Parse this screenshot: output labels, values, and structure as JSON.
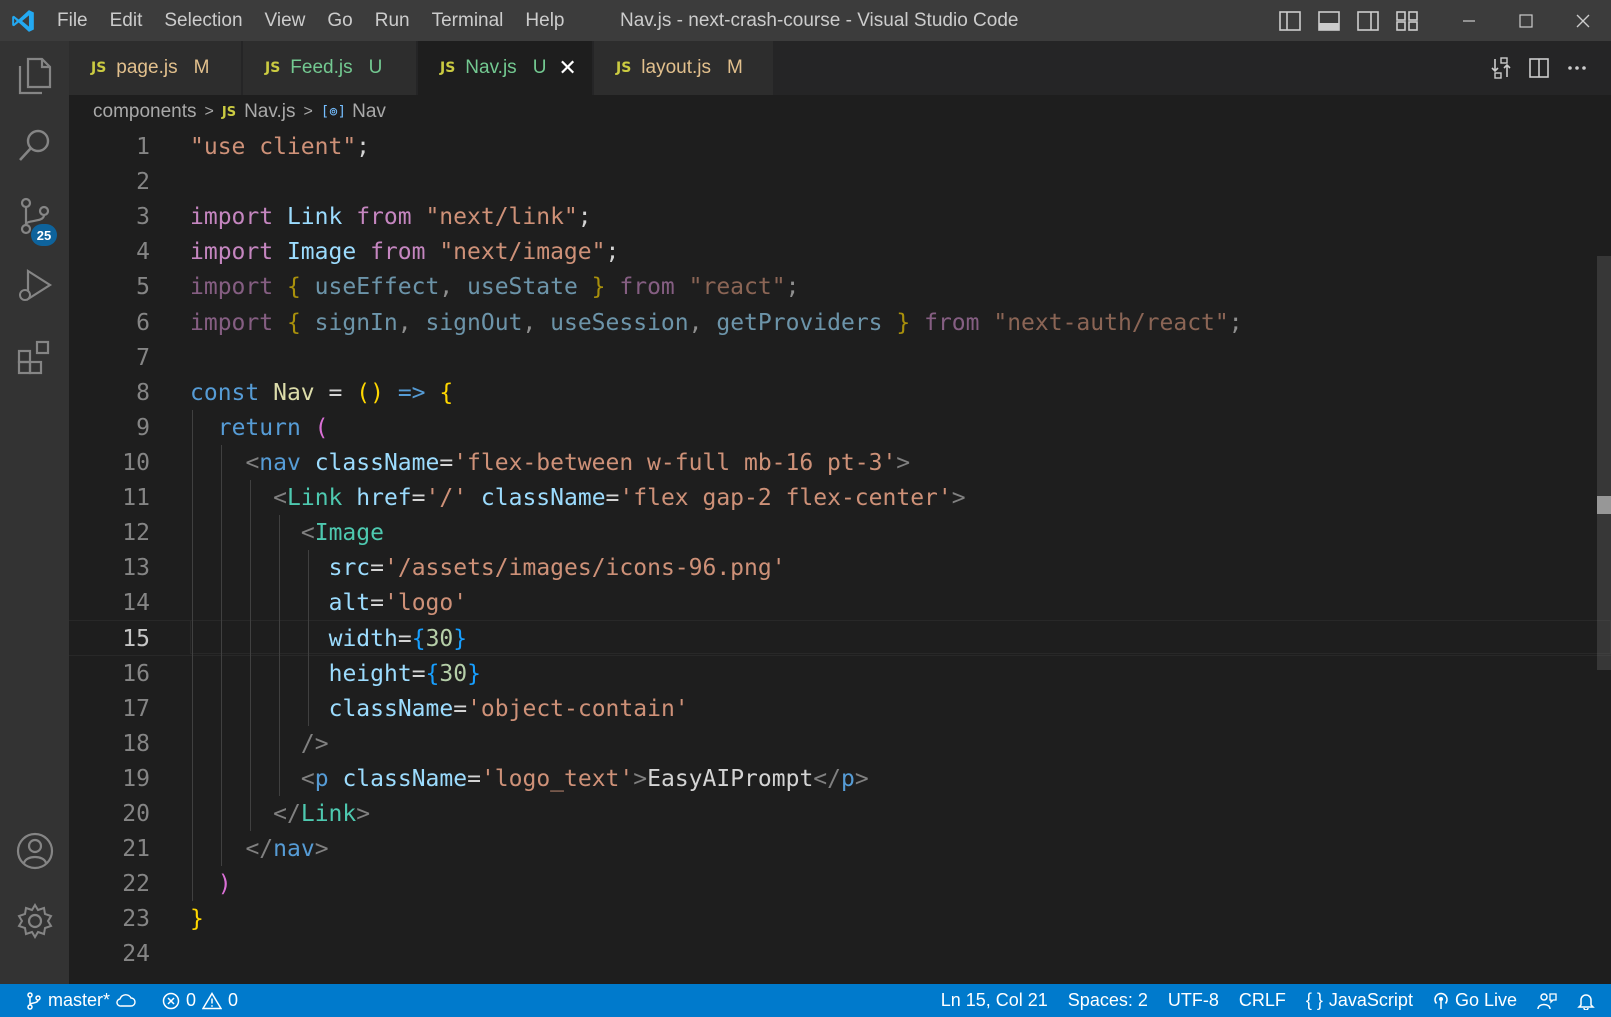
{
  "window": {
    "title": "Nav.js - next-crash-course - Visual Studio Code",
    "menu": [
      "File",
      "Edit",
      "Selection",
      "View",
      "Go",
      "Run",
      "Terminal",
      "Help"
    ]
  },
  "activity_bar": {
    "items": [
      "explorer-icon",
      "search-icon",
      "source-control-icon",
      "run-debug-icon",
      "extensions-icon"
    ],
    "source_control_badge": "25",
    "bottom_items": [
      "accounts-icon",
      "settings-gear-icon"
    ]
  },
  "tabs": [
    {
      "icon": "JS",
      "label": "page.js",
      "status": "M",
      "state": "modified",
      "active": false
    },
    {
      "icon": "JS",
      "label": "Feed.js",
      "status": "U",
      "state": "untracked",
      "active": false
    },
    {
      "icon": "JS",
      "label": "Nav.js",
      "status": "U",
      "state": "untracked",
      "active": true,
      "close": "✕"
    },
    {
      "icon": "JS",
      "label": "layout.js",
      "status": "M",
      "state": "modified",
      "active": false
    }
  ],
  "breadcrumb": {
    "folder": "components",
    "file_icon": "JS",
    "file": "Nav.js",
    "symbol": "Nav"
  },
  "editor": {
    "current_line": 15,
    "line_numbers": [
      "1",
      "2",
      "3",
      "4",
      "5",
      "6",
      "7",
      "8",
      "9",
      "10",
      "11",
      "12",
      "13",
      "14",
      "15",
      "16",
      "17",
      "18",
      "19",
      "20",
      "21",
      "22",
      "23",
      "24"
    ],
    "lines": [
      "\"use client\";",
      "",
      "import Link from \"next/link\";",
      "import Image from \"next/image\";",
      "import { useEffect, useState } from \"react\";",
      "import { signIn, signOut, useSession, getProviders } from \"next-auth/react\";",
      "",
      "const Nav = () => {",
      "  return (",
      "    <nav className='flex-between w-full mb-16 pt-3'>",
      "      <Link href='/' className='flex gap-2 flex-center'>",
      "        <Image",
      "          src='/assets/images/icons-96.png'",
      "          alt='logo'",
      "          width={30}",
      "          height={30}",
      "          className='object-contain'",
      "        />",
      "        <p className='logo_text'>EasyAIPrompt</p>",
      "      </Link>",
      "    </nav>",
      "  )",
      "}",
      ""
    ]
  },
  "status_bar": {
    "branch": "master*",
    "errors": "0",
    "warnings": "0",
    "cursor": "Ln 15, Col 21",
    "spaces": "Spaces: 2",
    "encoding": "UTF-8",
    "eol": "CRLF",
    "language_icon": "{ }",
    "language": "JavaScript",
    "go_live": "Go Live"
  },
  "colors": {
    "titlebar": "#3c3c3c",
    "activitybar": "#333333",
    "editor_bg": "#1e1e1e",
    "statusbar": "#007acc",
    "badge": "#0e639c"
  }
}
